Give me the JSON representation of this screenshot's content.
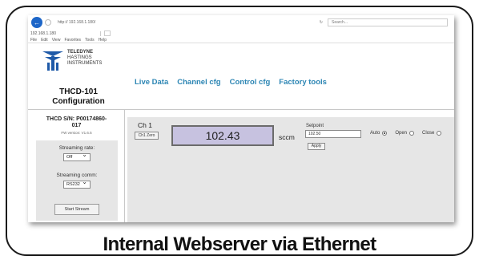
{
  "browser": {
    "url": "http:// 192.168.1.180/",
    "tab_label": "192.168.1.180",
    "search_placeholder": "Search...",
    "menu": [
      "File",
      "Edit",
      "View",
      "Favorites",
      "Tools",
      "Help"
    ]
  },
  "logo": {
    "brand": "TELEDYNE",
    "line2": "HASTINGS",
    "line3": "INSTRUMENTS",
    "accent_color": "#1f5aa8"
  },
  "app": {
    "title_line1": "THCD-101",
    "title_line2": "Configuration"
  },
  "nav": {
    "items": [
      "Live Data",
      "Channel cfg",
      "Control cfg",
      "Factory tools"
    ]
  },
  "sidebar": {
    "serial_line1": "THCD S/N:  P00174860-",
    "serial_line2": "017",
    "firmware": "FW version: V1.6.5",
    "streaming_rate_label": "Streaming rate:",
    "streaming_rate_value": "Off",
    "streaming_comm_label": "Streaming comm:",
    "streaming_comm_value": "RS232",
    "start_stream_label": "Start Stream"
  },
  "channel": {
    "name": "Ch 1",
    "zero_label": "Ch1 Zero",
    "flow_value": "102.43",
    "unit": "sccm",
    "setpoint_label": "Setpoint",
    "setpoint_value": "102.50",
    "apply_label": "Apply",
    "modes": [
      {
        "label": "Auto",
        "selected": true
      },
      {
        "label": "Open",
        "selected": false
      },
      {
        "label": "Close",
        "selected": false
      }
    ]
  },
  "caption": "Internal Webserver via Ethernet"
}
